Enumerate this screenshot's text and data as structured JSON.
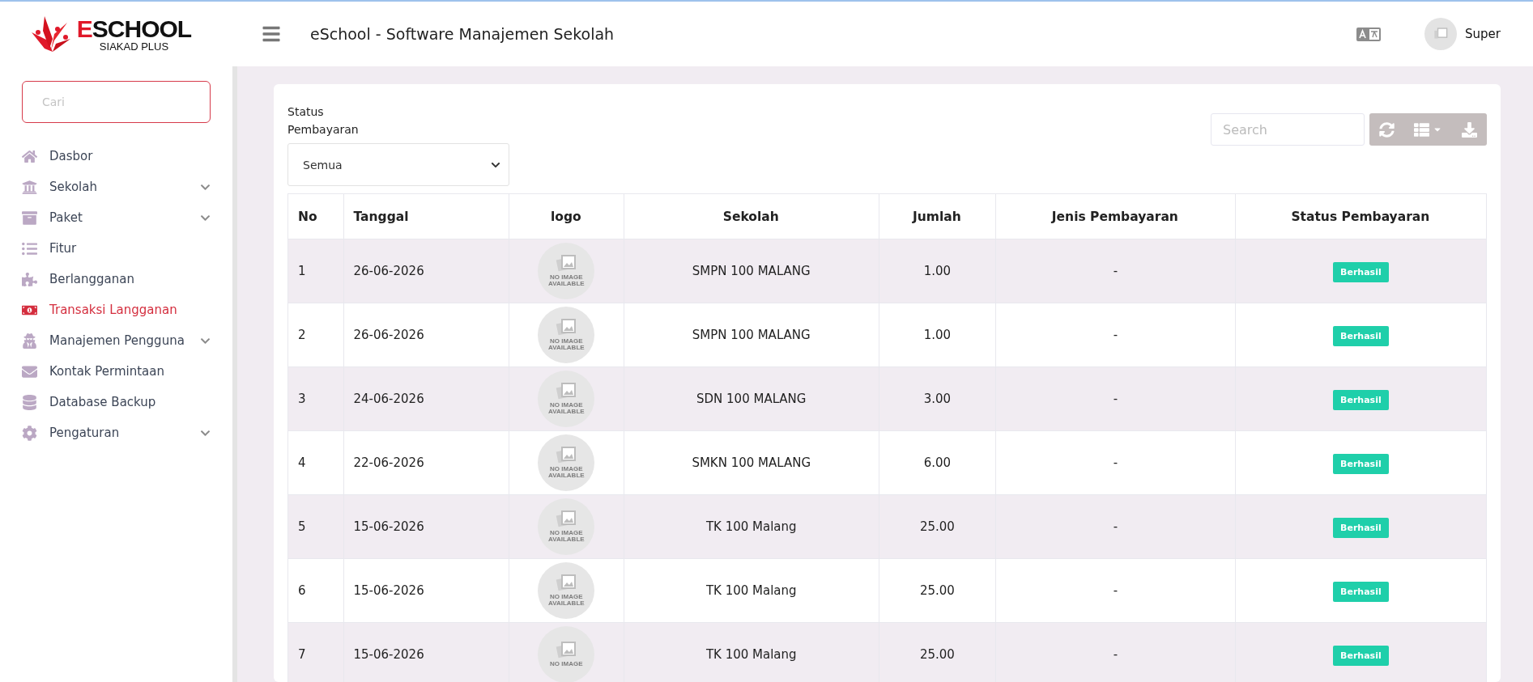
{
  "brand": {
    "accent": "E",
    "rest": "SCHOOL",
    "subtitle": "SIAKAD PLUS"
  },
  "header": {
    "title": "eSchool - Software Manajemen Sekolah",
    "user": "Super"
  },
  "sidebar": {
    "search": {
      "placeholder": "Cari"
    },
    "items": [
      {
        "label": "Dasbor",
        "selected": false,
        "expandable": false
      },
      {
        "label": "Sekolah",
        "selected": false,
        "expandable": true
      },
      {
        "label": "Paket",
        "selected": false,
        "expandable": true
      },
      {
        "label": "Fitur",
        "selected": false,
        "expandable": false
      },
      {
        "label": "Berlangganan",
        "selected": false,
        "expandable": false
      },
      {
        "label": "Transaksi Langganan",
        "selected": true,
        "expandable": false
      },
      {
        "label": "Manajemen Pengguna",
        "selected": false,
        "expandable": true
      },
      {
        "label": "Kontak Permintaan",
        "selected": false,
        "expandable": false
      },
      {
        "label": "Database Backup",
        "selected": false,
        "expandable": false
      },
      {
        "label": "Pengaturan",
        "selected": false,
        "expandable": true
      }
    ]
  },
  "filter": {
    "label": "Status Pembayaran",
    "value": "Semua"
  },
  "toolbar": {
    "search": {
      "placeholder": "Search"
    }
  },
  "table": {
    "columns": [
      "No",
      "Tanggal",
      "logo",
      "Sekolah",
      "Jumlah",
      "Jenis Pembayaran",
      "Status Pembayaran"
    ],
    "rows": [
      {
        "no": "1",
        "date": "26-06-2026",
        "logo": "NO IMAGE AVAILABLE",
        "school": "SMPN 100 MALANG",
        "amount": "1.00",
        "type": "-",
        "status": "Berhasil"
      },
      {
        "no": "2",
        "date": "26-06-2026",
        "logo": "NO IMAGE AVAILABLE",
        "school": "SMPN 100 MALANG",
        "amount": "1.00",
        "type": "-",
        "status": "Berhasil"
      },
      {
        "no": "3",
        "date": "24-06-2026",
        "logo": "NO IMAGE AVAILABLE",
        "school": "SDN 100 MALANG",
        "amount": "3.00",
        "type": "-",
        "status": "Berhasil"
      },
      {
        "no": "4",
        "date": "22-06-2026",
        "logo": "NO IMAGE AVAILABLE",
        "school": "SMKN 100 MALANG",
        "amount": "6.00",
        "type": "-",
        "status": "Berhasil"
      },
      {
        "no": "5",
        "date": "15-06-2026",
        "logo": "NO IMAGE AVAILABLE",
        "school": "TK 100 Malang",
        "amount": "25.00",
        "type": "-",
        "status": "Berhasil"
      },
      {
        "no": "6",
        "date": "15-06-2026",
        "logo": "NO IMAGE AVAILABLE",
        "school": "TK 100 Malang",
        "amount": "25.00",
        "type": "-",
        "status": "Berhasil"
      },
      {
        "no": "7",
        "date": "15-06-2026",
        "logo": "NO IMAGE",
        "school": "TK 100 Malang",
        "amount": "25.00",
        "type": "-",
        "status": "Berhasil"
      }
    ]
  }
}
